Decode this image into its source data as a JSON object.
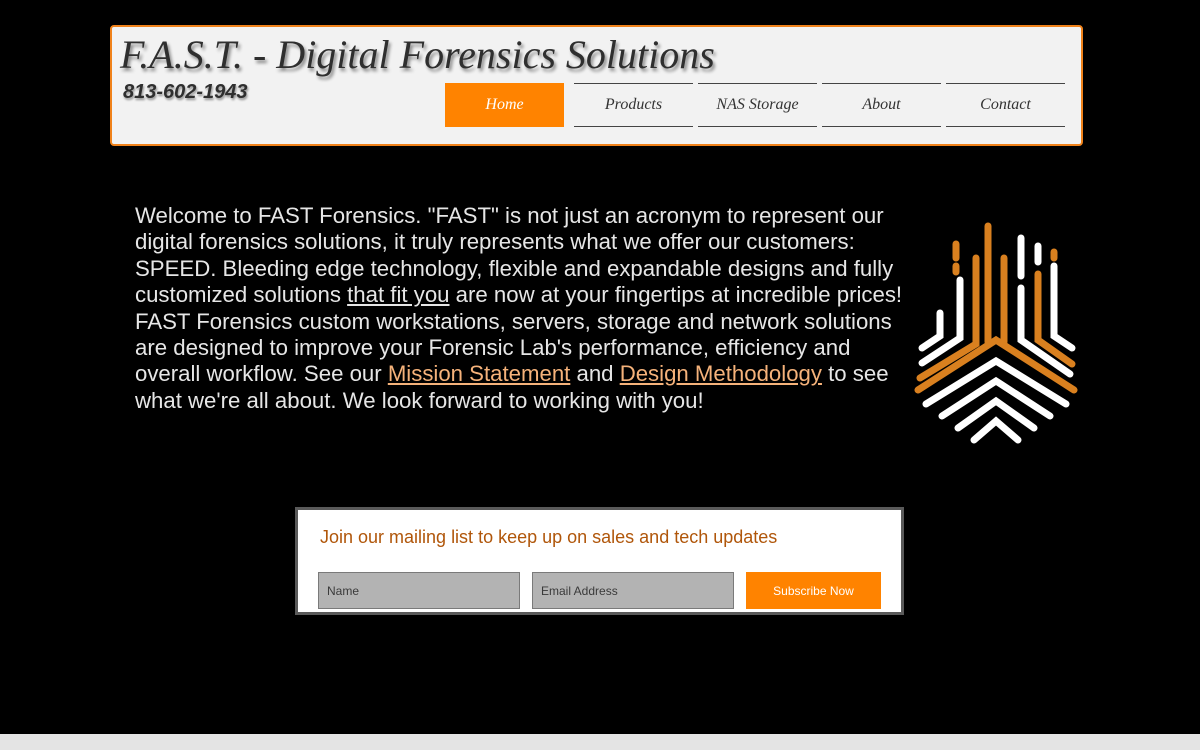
{
  "header": {
    "title": "F.A.S.T. - Digital Forensics Solutions",
    "phone": "813-602-1943"
  },
  "nav": {
    "items": [
      {
        "label": "Home",
        "active": true
      },
      {
        "label": "Products",
        "active": false
      },
      {
        "label": "NAS Storage",
        "active": false
      },
      {
        "label": "About",
        "active": false
      },
      {
        "label": "Contact",
        "active": false
      }
    ]
  },
  "welcome": {
    "part1": "Welcome to FAST Forensics.  \"FAST\" is not just an acronym to represent our digital forensics solutions, it truly represents what we offer our customers:  SPEED.  Bleeding edge technology, flexible and expandable designs and fully customized solutions ",
    "underline_text": "that fit you",
    "part2": " are now at your fingertips at incredible prices!  FAST Forensics custom workstations, servers, storage and network solutions are designed to improve your Forensic Lab's performance, efficiency and overall workflow.  See our ",
    "link1": "Mission Statement",
    "part3": "  and ",
    "link2": "Design Methodology",
    "part4": " to see what we're all about.  We look forward to working with you!"
  },
  "mailing": {
    "title": "Join our mailing list to keep up on sales and tech updates",
    "name_placeholder": "Name",
    "email_placeholder": "Email Address",
    "subscribe_label": "Subscribe Now"
  },
  "colors": {
    "accent": "#ff8300",
    "background": "#000000",
    "header_bg": "#f2f2f2",
    "link": "#f5b27a",
    "mail_title": "#b0560a"
  },
  "icons": [
    "fingerprint-logo-icon"
  ]
}
